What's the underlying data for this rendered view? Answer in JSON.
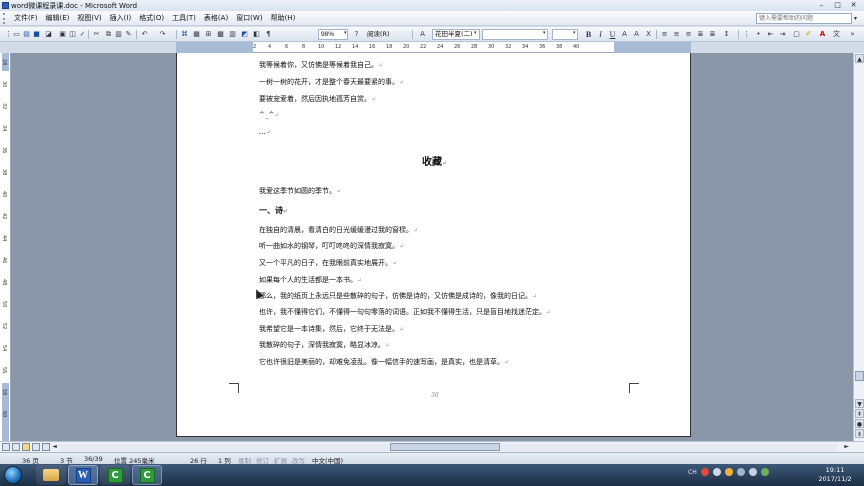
{
  "titlebar": {
    "title": "word微课程录课.doc - Microsoft Word",
    "minimize": "–",
    "maximize": "□",
    "close": "✕"
  },
  "menubar": {
    "items": [
      "文件(F)",
      "编辑(E)",
      "视图(V)",
      "插入(I)",
      "格式(O)",
      "工具(T)",
      "表格(A)",
      "窗口(W)",
      "帮助(H)"
    ],
    "help_placeholder": "键入需要帮助的问题"
  },
  "toolbar": {
    "zoom": "98%",
    "read_label": "阅读(R)",
    "font_name": "花田半夏(二)",
    "font_size": "",
    "style_box": ""
  },
  "ruler": {
    "h_ticks": [
      "2",
      "2",
      "4",
      "6",
      "8",
      "10",
      "12",
      "14",
      "16",
      "18",
      "20",
      "22",
      "24",
      "26",
      "28",
      "30",
      "32",
      "34",
      "36",
      "38",
      "40"
    ],
    "v_ticks": [
      "28",
      "30",
      "32",
      "34",
      "36",
      "38",
      "40",
      "42",
      "44",
      "46",
      "48",
      "50",
      "52",
      "54",
      "56",
      "58",
      "60"
    ]
  },
  "document": {
    "lines_top": [
      "我等候着你，又仿佛是等候着我自己。",
      "一树一树的花开，才是整个春天最要紧的事。",
      "要被宠爱着，然后因执地孤芳自赏。",
      "^_^",
      "..."
    ],
    "heading": "收藏",
    "intro": "我爱这季节如圆的季节。",
    "section_title": "一、诗",
    "lines_bottom": [
      "在独自的清晨，看清白的日光缓缓漫过我的窗棂。",
      "听一曲如水的钢琴，叮叮咚咚的深情我寂寞。",
      "又一个平凡的日子，在我眼前真实地展开。",
      "如果每个人的生活都是一本书。",
      "那么，我的纸页上永远只是些散碎的句子，仿佛是诗的，又仿佛是成诗的，像我的日记。",
      "也许，我不懂得它们，不懂得一句句零落的词语。正如我不懂得生活，只是盲目地找迷茫定。",
      "我希望它是一本诗集，然后，它终于无法是。",
      "我散碎的句子，深情我寂寞，略显冰凉。",
      "它也许很旧是美丽的，却难免凌乱。像一幅信手的速写画，是真实，也是清草。"
    ],
    "paragraph_mark": "↵",
    "page_number": "36"
  },
  "statusbar": {
    "page": "36 页",
    "section": "3 节",
    "page_of": "36/39",
    "position": "位置 245毫米",
    "line": "26 行",
    "column": "1 列",
    "rec": "录制",
    "trk": "修订",
    "ext": "扩展",
    "ovr": "改写",
    "language": "中文(中国)"
  },
  "taskbar": {
    "word_icon": "W",
    "cam_icon": "C",
    "tray_ch": "CH",
    "time": "19:11",
    "date": "2017/11/2"
  },
  "colors": {
    "accent": "#2b5fb3",
    "page_bg": "#ffffff",
    "workspace": "#8a97a8"
  }
}
